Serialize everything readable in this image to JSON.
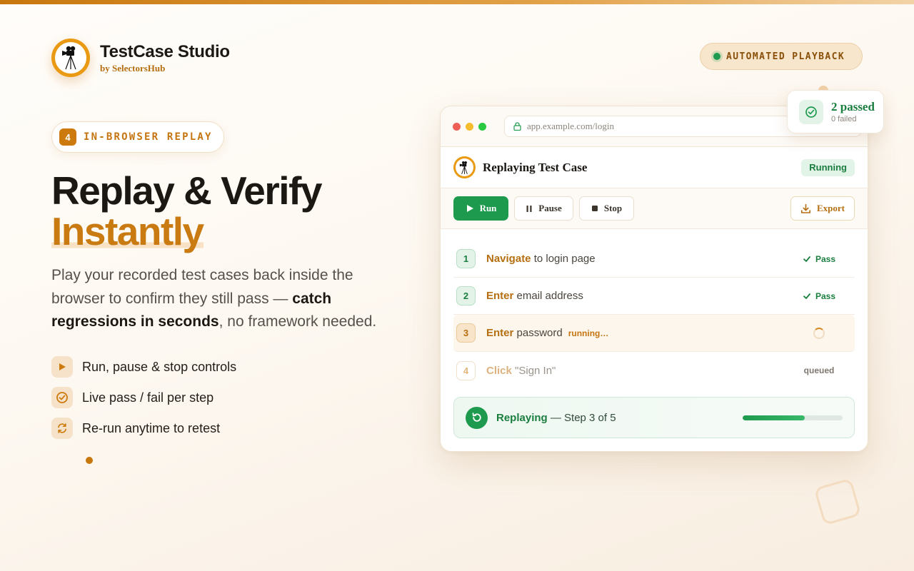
{
  "brand": {
    "title": "TestCase Studio",
    "subtitle": "by SelectorsHub",
    "logo_icon": "camera-tripod-icon"
  },
  "playback_pill": {
    "label": "AUTOMATED PLAYBACK"
  },
  "badge": {
    "number": "4",
    "label": "IN-BROWSER REPLAY"
  },
  "hero": {
    "headline_line1": "Replay & Verify",
    "headline_line2": "Instantly",
    "description_part1": "Play your recorded test cases back inside the browser to confirm they still pass — ",
    "description_bold": "catch regressions in seconds",
    "description_part2": ", no framework needed."
  },
  "features": [
    {
      "icon": "play-icon",
      "label": "Run, pause & stop controls"
    },
    {
      "icon": "check-circle-icon",
      "label": "Live pass / fail per step"
    },
    {
      "icon": "refresh-icon",
      "label": "Re-run anytime to retest"
    }
  ],
  "browser": {
    "url": "app.example.com/login",
    "panel_title": "Replaying Test Case",
    "status": "Running",
    "toolbar": {
      "run_label": "Run",
      "pause_label": "Pause",
      "stop_label": "Stop",
      "export_label": "Export"
    },
    "steps": [
      {
        "number": "1",
        "action": "Navigate",
        "rest": " to login page",
        "status": "Pass"
      },
      {
        "number": "2",
        "action": "Enter",
        "rest": " email address",
        "status": "Pass"
      },
      {
        "number": "3",
        "action": "Enter",
        "rest": " password",
        "tag": "running…",
        "status": "running"
      },
      {
        "number": "4",
        "action": "Click",
        "rest": " \"Sign In\"",
        "status": "queued"
      }
    ],
    "progress": {
      "label_bold": "Replaying",
      "label_rest": " — Step 3 of 5",
      "fraction": 0.62
    }
  },
  "summary": {
    "passed": "2 passed",
    "failed": "0 failed"
  },
  "colors": {
    "accent": "#c97a10",
    "success": "#1e9a4e",
    "traffic_red": "#ed5f57",
    "traffic_yellow": "#f5bd2e",
    "traffic_green": "#28c840"
  }
}
